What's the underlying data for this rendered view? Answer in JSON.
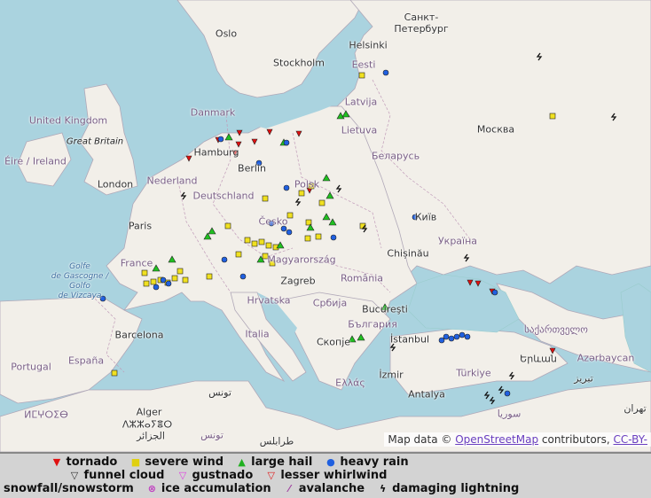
{
  "map": {
    "attribution": {
      "prefix": "Map data ©",
      "osm_link": "OpenStreetMap",
      "middle": "contributors,",
      "license_link": "CC-BY-"
    },
    "labels": {
      "oslo": "Oslo",
      "stockholm": "Stockholm",
      "helsinki": "Helsinki",
      "spb": "Санкт-Петербург",
      "eesti": "Eesti",
      "latvija": "Latvija",
      "lietuva": "Lietuva",
      "moskva": "Москва",
      "belarus": "Беларусь",
      "uk": "United Kingdom",
      "gb": "Great Britain",
      "eire": "Éire / Ireland",
      "danmark": "Danmark",
      "hamburg": "Hamburg",
      "berlin": "Berlin",
      "nederland": "Nederland",
      "london": "London",
      "deutschland": "Deutschland",
      "polska": "Polsk",
      "kyiv": "Київ",
      "ukraina": "Україна",
      "paris": "Paris",
      "cesko": "Česko",
      "france": "France",
      "magyar": "Magyarország",
      "chisinau": "Chișinău",
      "golfe": "Golfe\nde Gascogne /\nGolfo\nde Vizcaya",
      "zagreb": "Zagreb",
      "romania": "România",
      "hrvatska": "Hrvatska",
      "srbija": "Србија",
      "bucuresti": "Bucureşti",
      "balgaria": "България",
      "barcelona": "Barcelona",
      "italia": "Italia",
      "skopje": "Скопје",
      "istanbul": "İstanbul",
      "portugal": "Portugal",
      "espana": "España",
      "izmir": "İzmir",
      "turkiye": "Türkiye",
      "ellas": "Ελλάς",
      "antalya": "Antalya",
      "tunis": "تونس",
      "alger": "Alger",
      "alger2": "ⴷⵣⵣⴰⵢⴻⵔ",
      "alger3": "الجزائر",
      "maroc": "ⵍⵎⵖⵔⵉⴱ",
      "tounes": "تونس",
      "tarabulus": "طرابلس",
      "suria": "سوريا",
      "georgia": "საქართველო",
      "yerevan": "Երևան",
      "azerbaycan": "Azərbaycan",
      "tabriz": "تبریز",
      "tehran": "تهران"
    }
  },
  "legend": {
    "rows": [
      [
        {
          "symbol": "▼",
          "color": "#e01010",
          "label": "tornado"
        },
        {
          "symbol": "■",
          "color": "#f0e020",
          "label": "severe wind"
        },
        {
          "symbol": "▲",
          "color": "#20c020",
          "label": "large hail"
        },
        {
          "symbol": "●",
          "color": "#2060e0",
          "label": "heavy rain"
        }
      ],
      [
        {
          "symbol": "▽",
          "color": "#ffffff",
          "label": "funnel cloud"
        },
        {
          "symbol": "▽",
          "color": "#e040e0",
          "label": "gustnado"
        },
        {
          "symbol": "▽",
          "color": "#e02020",
          "label": "lesser whirlwind"
        }
      ],
      [
        {
          "symbol": "",
          "color": "#000000",
          "label": "snowfall/snowstorm"
        },
        {
          "symbol": "⊗",
          "color": "#c040c0",
          "label": "ice accumulation"
        },
        {
          "symbol": "⁄",
          "color": "#a040a0",
          "label": "avalanche"
        },
        {
          "symbol": "ϟ",
          "color": "#111111",
          "label": "damaging lightning"
        }
      ]
    ]
  }
}
